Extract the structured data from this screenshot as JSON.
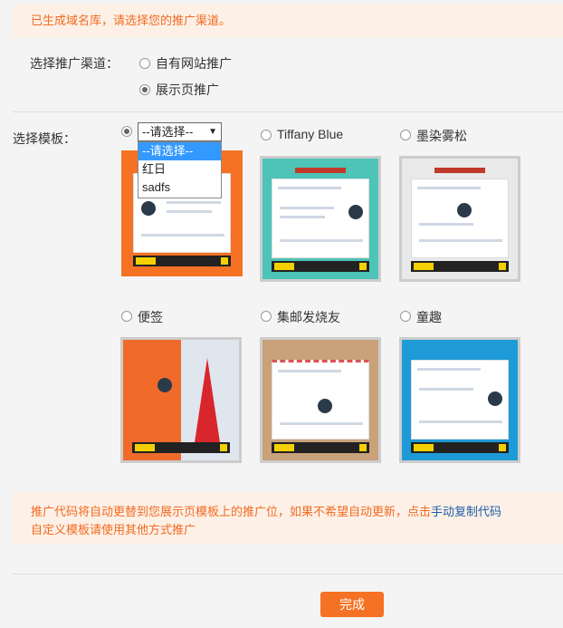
{
  "notice_top": "已生成域名库，请选择您的推广渠道。",
  "channel": {
    "label": "选择推广渠道：",
    "options": [
      "自有网站推广",
      "展示页推广"
    ],
    "selected_index": 1
  },
  "template": {
    "label": "选择模板：",
    "select_value": "--请选择--",
    "dropdown_options": [
      "--请选择--",
      "红日",
      "sadfs"
    ],
    "items": [
      {
        "name": "",
        "theme": "#f57224"
      },
      {
        "name": "Tiffany Blue",
        "theme": "#4ec3b7"
      },
      {
        "name": "墨染雾松",
        "theme": "#e9e9e9"
      },
      {
        "name": "便签",
        "theme": "#f06a2a"
      },
      {
        "name": "集邮发烧友",
        "theme": "#c9a27a"
      },
      {
        "name": "童趣",
        "theme": "#1e9ad6"
      }
    ]
  },
  "notice_bottom": {
    "line1_prefix": "推广代码将自动更替到您展示页模板上的推广位，如果不希望自动更新，点击",
    "line1_link": "手动复制代码",
    "line2": "自定义模板请使用其他方式推广"
  },
  "submit_label": "完成",
  "colors": {
    "accent": "#f57224",
    "notice_bg": "#fdf0e6",
    "link": "#1f5fa8"
  }
}
